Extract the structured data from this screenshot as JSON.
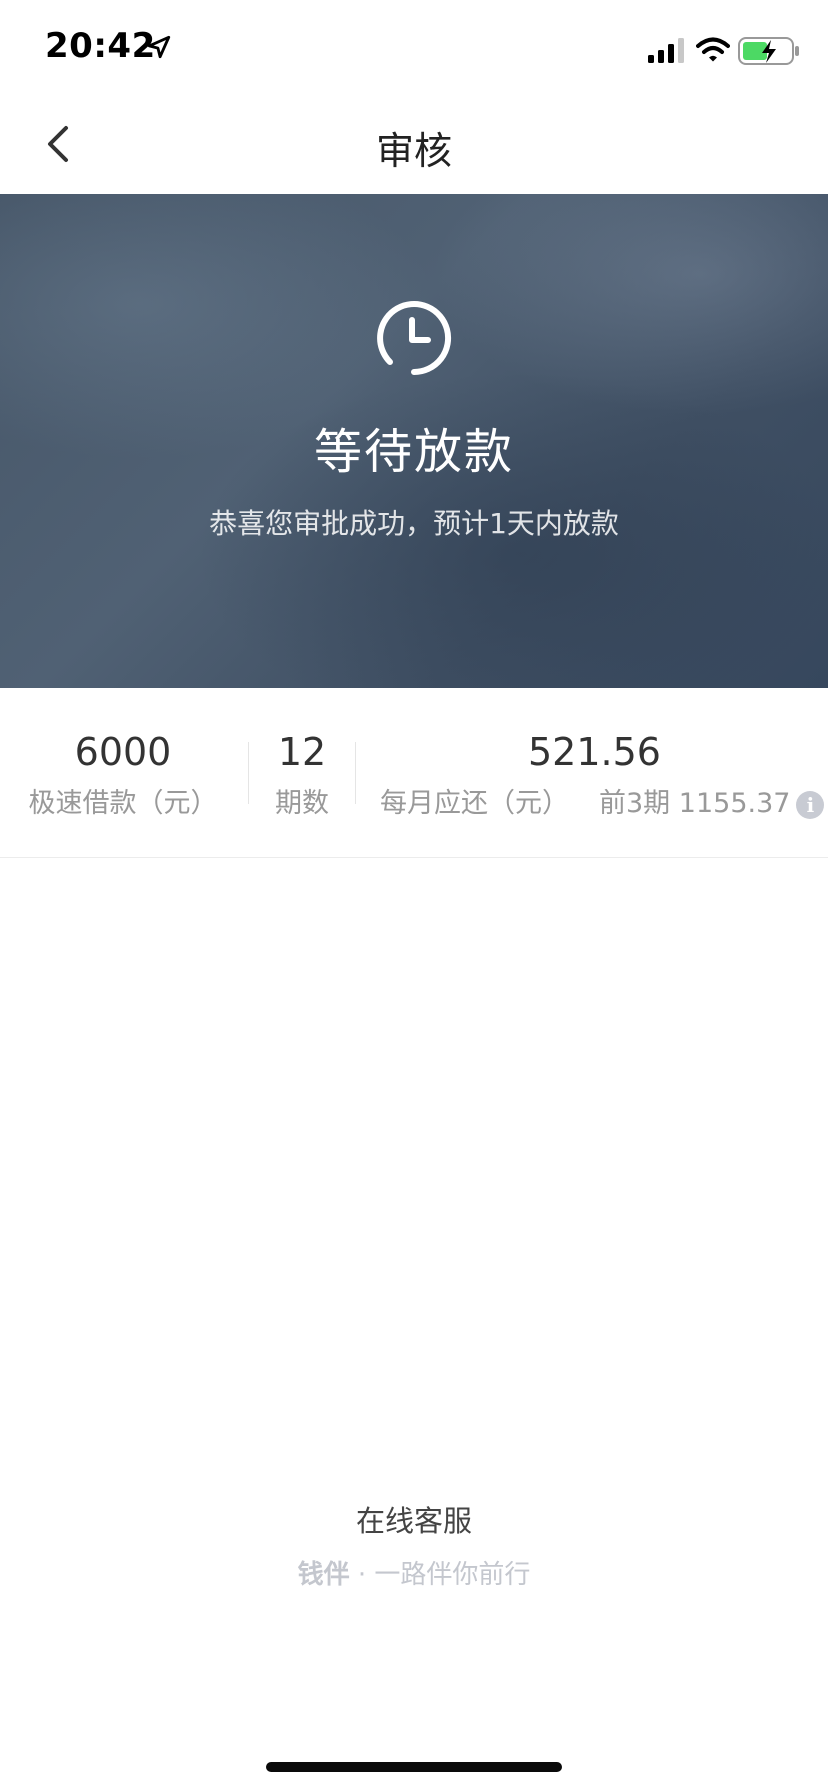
{
  "status_bar": {
    "time": "20:42",
    "icons": [
      "location-arrow-icon",
      "cellular-signal-icon",
      "wifi-icon",
      "battery-charging-icon"
    ]
  },
  "nav": {
    "title": "审核",
    "back_icon": "chevron-left-icon"
  },
  "banner": {
    "icon": "clock-icon",
    "title": "等待放款",
    "description": "恭喜您审批成功，预计1天内放款"
  },
  "summary": {
    "amount": {
      "value": "6000",
      "label": "极速借款（元）"
    },
    "periods": {
      "value": "12",
      "label": "期数"
    },
    "monthly": {
      "value": "521.56",
      "label": "每月应还（元）",
      "first_periods_label": "前3期",
      "first_periods_value": "1155.37",
      "info_icon": "info-icon"
    }
  },
  "footer": {
    "support_label": "在线客服",
    "brand": "钱伴",
    "slogan": "· 一路伴你前行"
  },
  "colors": {
    "banner_bg": "#465668",
    "text_primary": "#333333",
    "text_secondary": "#999999",
    "slogan_text": "#c4c7ce"
  }
}
